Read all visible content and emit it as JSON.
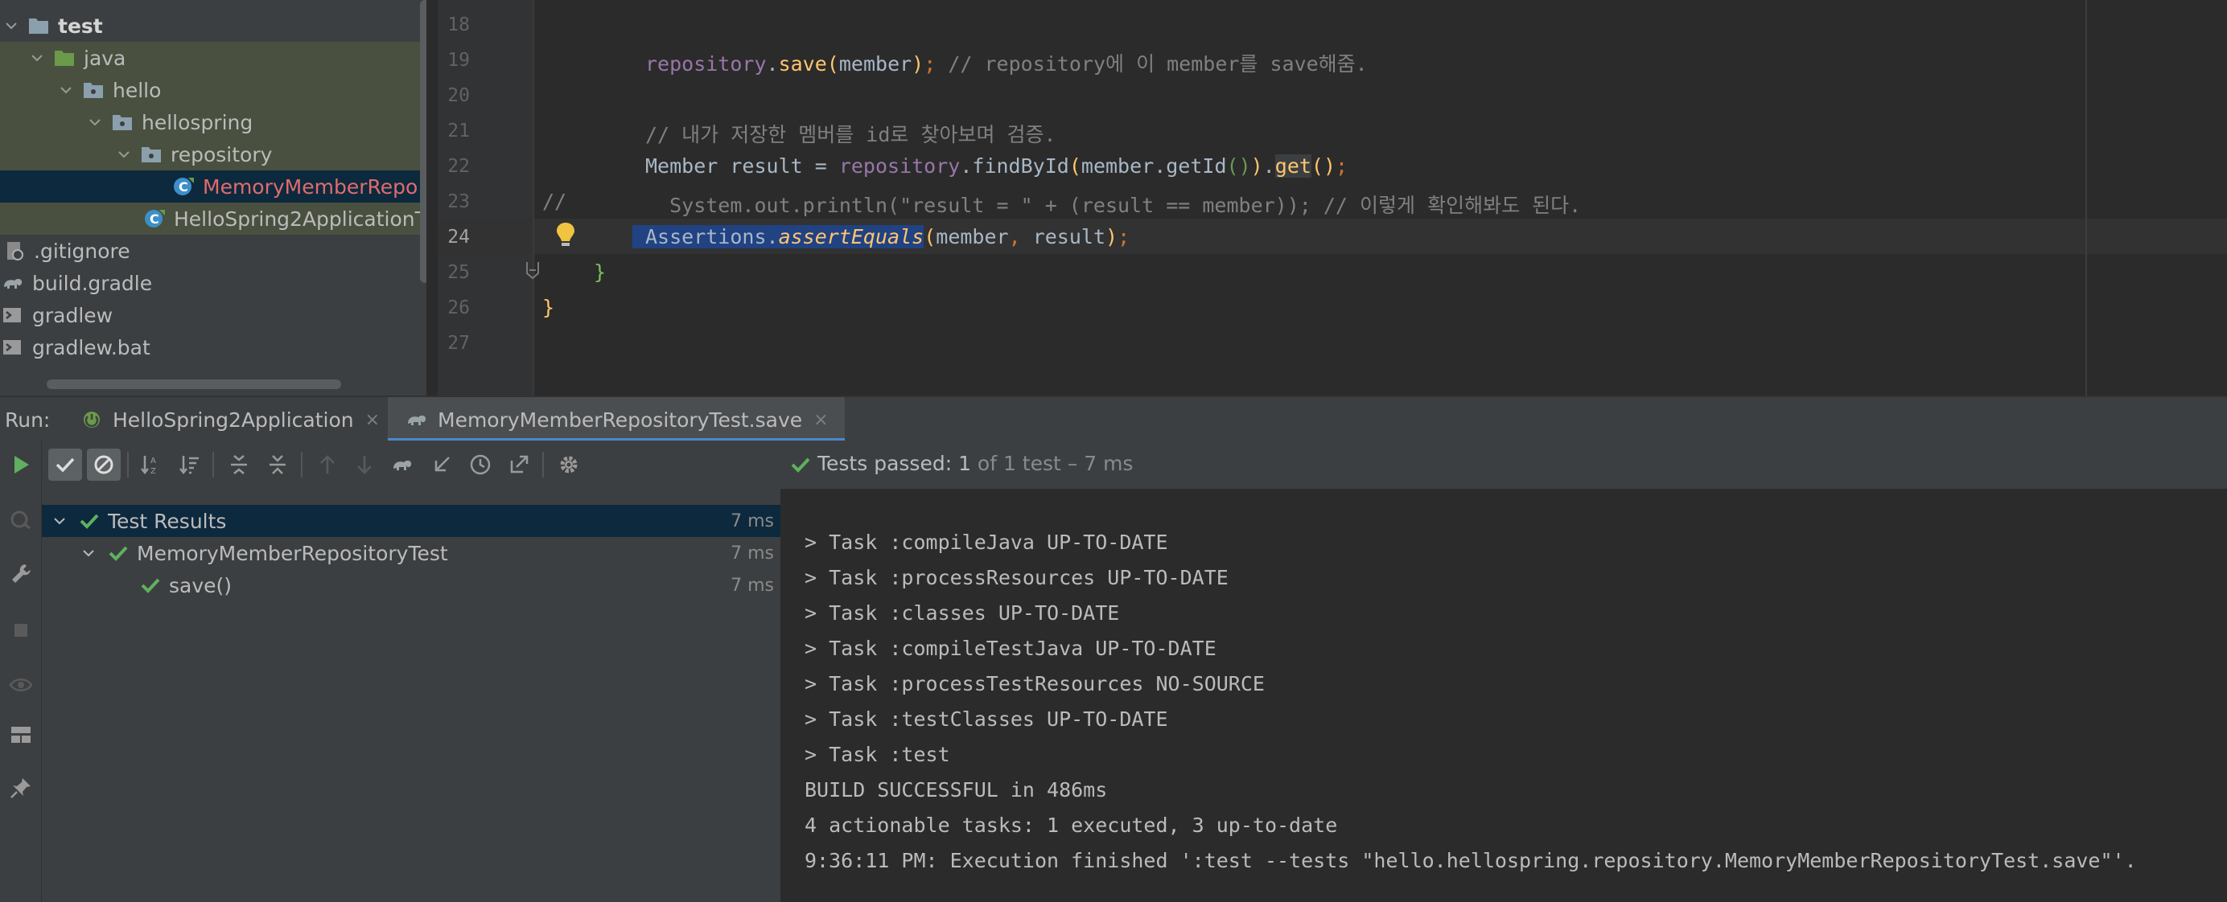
{
  "project_tree": {
    "items": [
      {
        "label": "test",
        "bold": true
      },
      {
        "label": "java"
      },
      {
        "label": "hello"
      },
      {
        "label": "hellospring"
      },
      {
        "label": "repository"
      },
      {
        "label": "MemoryMemberRepo"
      },
      {
        "label": "HelloSpring2ApplicationT"
      },
      {
        "label": ".gitignore"
      },
      {
        "label": "build.gradle"
      },
      {
        "label": "gradlew"
      },
      {
        "label": "gradlew.bat"
      }
    ]
  },
  "editor": {
    "line_numbers": [
      "18",
      "19",
      "20",
      "21",
      "22",
      "23",
      "24",
      "25",
      "26",
      "27"
    ],
    "current_line": "24",
    "line19": {
      "obj": "repository",
      "dot": ".",
      "method": "save",
      "open": "(",
      "arg": "member",
      "close": ")",
      "semi": ";",
      "comment": " // repository에 이 member를 save해줌."
    },
    "line21": {
      "comment": "// 내가 저장한 멤버를 id로 찾아보며 검증."
    },
    "line22": {
      "type": "Member result = ",
      "obj": "repository",
      "dot1": ".",
      "call": "findById",
      "open1": "(",
      "arg": "member.getId",
      "open2": "(",
      "close2": ")",
      "close1": ")",
      "dot2": ".",
      "get": "get",
      "empty": "()",
      "semi": ";"
    },
    "line23": {
      "prefix": "//",
      "code": "  System.out.println(\"result = \" + (result == member)); // 이렇게 확인해봐도 된다."
    },
    "line24": {
      "cls": "Assertions.",
      "method": "assertEquals",
      "open": "(",
      "arg1": "member",
      "comma": ",",
      "arg2": " result",
      "close": ")",
      "semi": ";"
    },
    "line25": {
      "brace": "}"
    },
    "line26": {
      "brace": "}"
    }
  },
  "run": {
    "label": "Run:",
    "tabs": [
      {
        "label": "HelloSpring2Application",
        "close": "×"
      },
      {
        "label": "MemoryMemberRepositoryTest.save",
        "close": "×"
      }
    ],
    "status": {
      "passed": "Tests passed: ",
      "count": "1",
      "rest": " of 1 test – 7 ms"
    },
    "results": [
      {
        "label": "Test Results",
        "time": "7 ms"
      },
      {
        "label": "MemoryMemberRepositoryTest",
        "time": "7 ms"
      },
      {
        "label": "save()",
        "time": "7 ms"
      }
    ],
    "console": [
      "> Task :compileJava UP-TO-DATE",
      "> Task :processResources UP-TO-DATE",
      "> Task :classes UP-TO-DATE",
      "> Task :compileTestJava UP-TO-DATE",
      "> Task :processTestResources NO-SOURCE",
      "> Task :testClasses UP-TO-DATE",
      "> Task :test",
      "BUILD SUCCESSFUL in 486ms",
      "4 actionable tasks: 1 executed, 3 up-to-date",
      "9:36:11 PM: Execution finished ':test --tests \"hello.hellospring.repository.MemoryMemberRepositoryTest.save\"'."
    ]
  },
  "colors": {
    "accent": "#4a88c7",
    "pass_green": "#5fb15f",
    "selection": "#214283"
  }
}
